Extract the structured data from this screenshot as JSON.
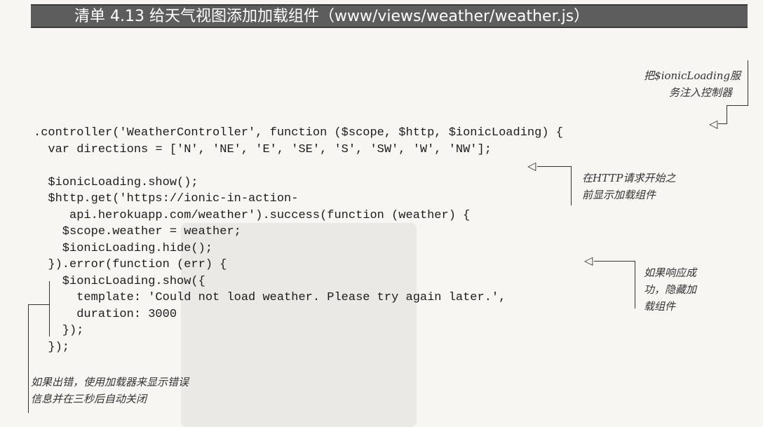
{
  "title": "清单 4.13   给天气视图添加加载组件（www/views/weather/weather.js）",
  "code_lines": [
    ".controller('WeatherController', function ($scope, $http, $ionicLoading) {",
    "  var directions = ['N', 'NE', 'E', 'SE', 'S', 'SW', 'W', 'NW'];",
    "",
    "  $ionicLoading.show();",
    "  $http.get('https://ionic-in-action-",
    "     api.herokuapp.com/weather').success(function (weather) {",
    "    $scope.weather = weather;",
    "    $ionicLoading.hide();",
    "  }).error(function (err) {",
    "    $ionicLoading.show({",
    "      template: 'Could not load weather. Please try again later.',",
    "      duration: 3000",
    "    });",
    "  });"
  ],
  "annotations": {
    "inject": [
      "把$ionicLoading服",
      "务注入控制器"
    ],
    "show_before": [
      "在HTTP请求开始之",
      "前显示加载组件"
    ],
    "hide_on_success": [
      "如果响应成",
      "功，隐藏加",
      "载组件"
    ],
    "error_info": [
      "如果出错，使用加载器来显示错误",
      "信息并在三秒后自动关闭"
    ]
  }
}
